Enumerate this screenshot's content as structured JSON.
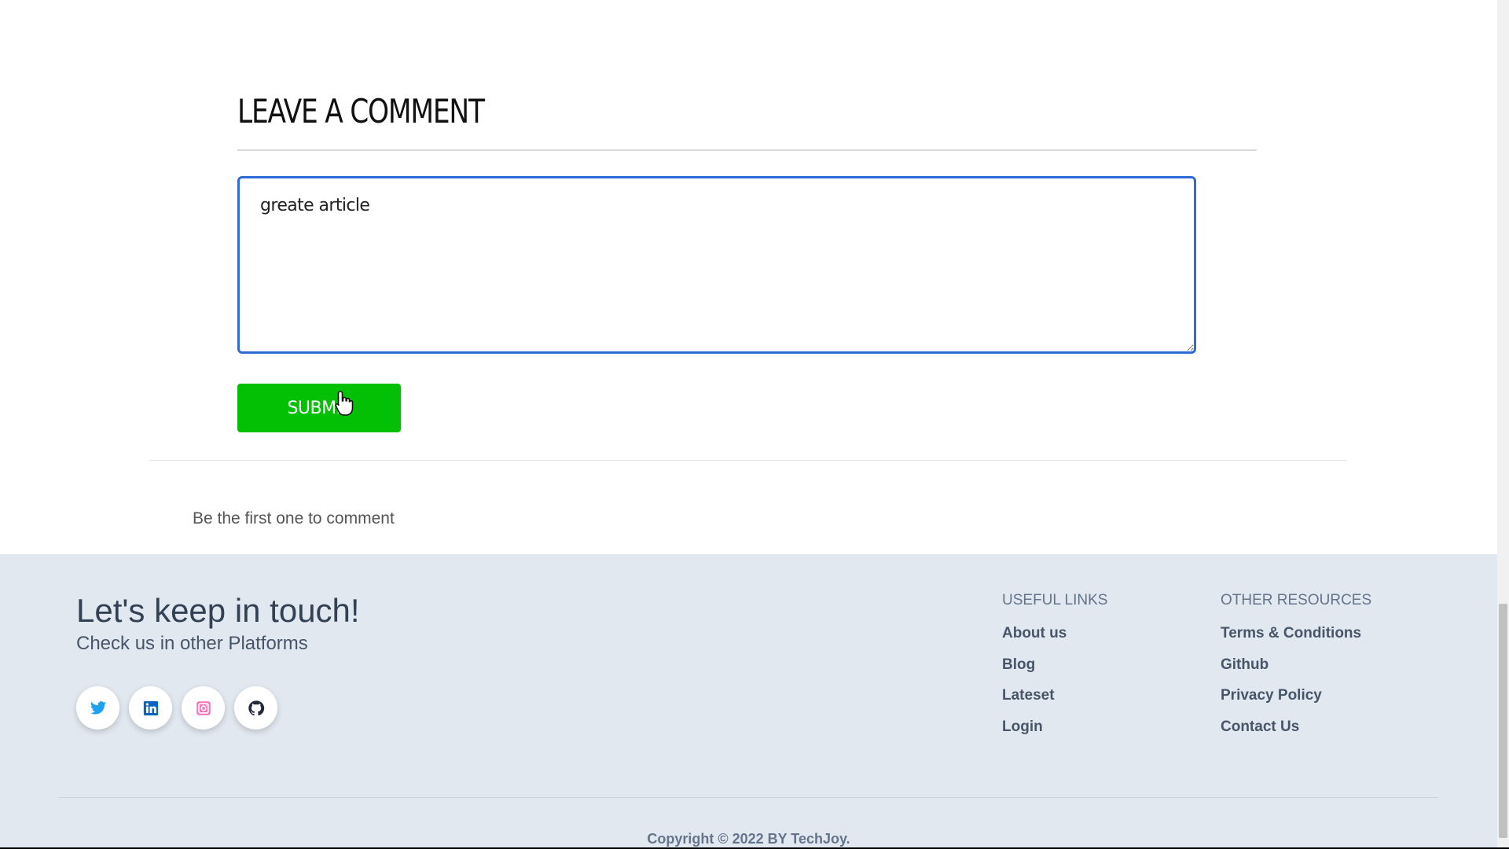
{
  "comment_section": {
    "title": "LEAVE A COMMENT",
    "textarea_value": "greate article",
    "submit_label": "SUBMIT",
    "empty_message": "Be the first one to comment"
  },
  "footer": {
    "heading": "Let's keep in touch!",
    "subheading": "Check us in other Platforms",
    "social": [
      {
        "icon": "twitter-icon",
        "color": "#1da1f2"
      },
      {
        "icon": "linkedin-icon",
        "color": "#0a66c2"
      },
      {
        "icon": "instagram-icon",
        "color": "#ec4899"
      },
      {
        "icon": "github-icon",
        "color": "#1f2937"
      }
    ],
    "useful_links": {
      "title": "USEFUL LINKS",
      "items": [
        "About us",
        "Blog",
        "Lateset",
        "Login"
      ]
    },
    "other_resources": {
      "title": "OTHER RESOURCES",
      "items": [
        "Terms & Conditions",
        "Github",
        "Privacy Policy",
        "Contact Us"
      ]
    },
    "copyright": "Copyright © 2022 BY TechJoy."
  },
  "colors": {
    "submit_green": "#04c004",
    "focus_blue": "#2f6bd6",
    "footer_bg": "#e2e8f0"
  }
}
